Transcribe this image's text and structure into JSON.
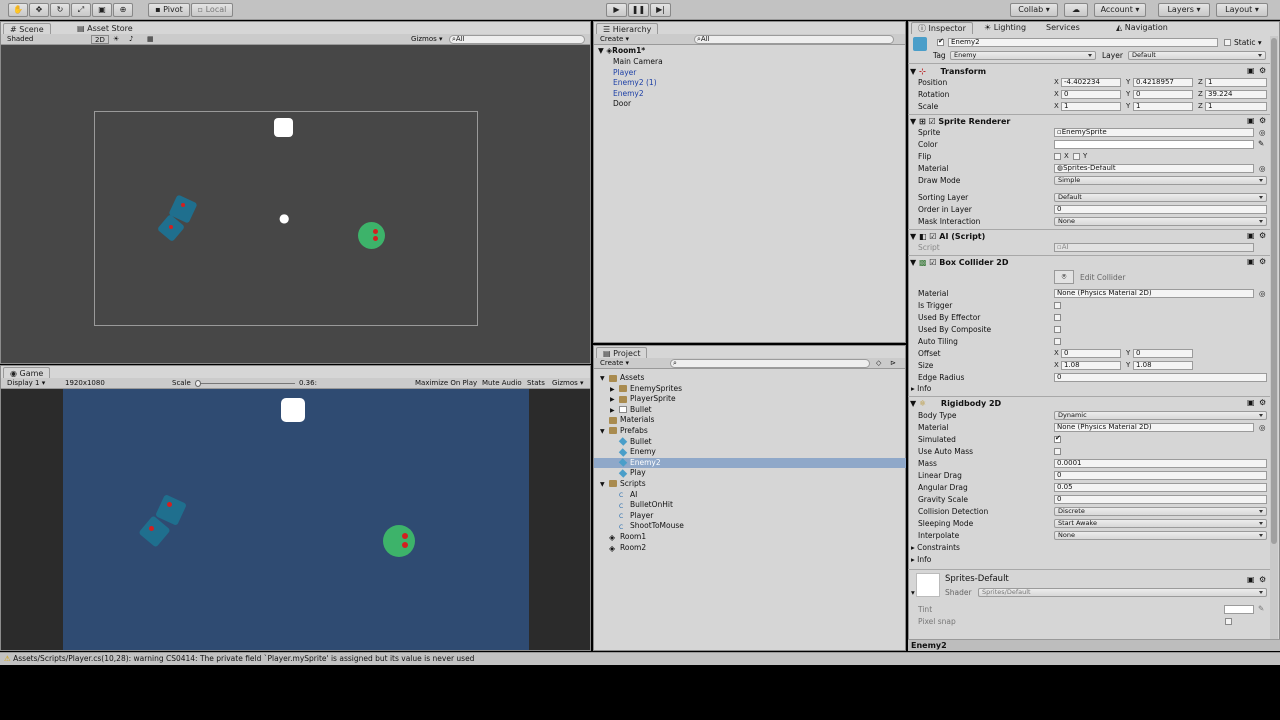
{
  "toolbar": {
    "pivot": "Pivot",
    "local": "Local",
    "collab": "Collab ▾",
    "account": "Account",
    "layers": "Layers",
    "layout": "Layout"
  },
  "scene": {
    "tab": "Scene",
    "tab2": "Asset Store",
    "shading": "Shaded",
    "mode2d": "2D",
    "gizmos": "Gizmos",
    "search": "All"
  },
  "game": {
    "tab": "Game",
    "display": "Display 1",
    "resolution": "1920x1080",
    "scale_label": "Scale",
    "scale_value": "0.36:",
    "maximize": "Maximize On Play",
    "mute": "Mute Audio",
    "stats": "Stats",
    "gizmos": "Gizmos"
  },
  "hierarchy": {
    "tab": "Hierarchy",
    "create": "Create",
    "search": "All",
    "scene": "Room1*",
    "items": [
      "Main Camera",
      "Player",
      "Enemy2 (1)",
      "Enemy2",
      "Door"
    ]
  },
  "project": {
    "tab": "Project",
    "create": "Create",
    "tree": [
      {
        "label": "Assets",
        "icon": "folder",
        "indent": 0,
        "arrow": "open"
      },
      {
        "label": "EnemySprites",
        "icon": "folder",
        "indent": 1,
        "arrow": "closed"
      },
      {
        "label": "PlayerSprite",
        "icon": "folder",
        "indent": 1,
        "arrow": "closed"
      },
      {
        "label": "Bullet",
        "icon": "sprite",
        "indent": 1,
        "arrow": "closed"
      },
      {
        "label": "Materials",
        "icon": "folder",
        "indent": 0,
        "arrow": "none"
      },
      {
        "label": "Prefabs",
        "icon": "folder",
        "indent": 0,
        "arrow": "open"
      },
      {
        "label": "Bullet",
        "icon": "prefab",
        "indent": 1,
        "arrow": "none"
      },
      {
        "label": "Enemy",
        "icon": "prefab",
        "indent": 1,
        "arrow": "none"
      },
      {
        "label": "Enemy2",
        "icon": "prefab",
        "indent": 1,
        "arrow": "none",
        "selected": true
      },
      {
        "label": "Play",
        "icon": "prefab",
        "indent": 1,
        "arrow": "none"
      },
      {
        "label": "Scripts",
        "icon": "folder",
        "indent": 0,
        "arrow": "open"
      },
      {
        "label": "AI",
        "icon": "script",
        "indent": 1,
        "arrow": "none"
      },
      {
        "label": "BulletOnHit",
        "icon": "script",
        "indent": 1,
        "arrow": "none"
      },
      {
        "label": "Player",
        "icon": "script",
        "indent": 1,
        "arrow": "none"
      },
      {
        "label": "ShootToMouse",
        "icon": "script",
        "indent": 1,
        "arrow": "none"
      },
      {
        "label": "Room1",
        "icon": "unity",
        "indent": 0,
        "arrow": "none"
      },
      {
        "label": "Room2",
        "icon": "unity",
        "indent": 0,
        "arrow": "none"
      }
    ]
  },
  "inspector": {
    "tabs": [
      "Inspector",
      "Lighting",
      "Services",
      "Navigation"
    ],
    "object_name": "Enemy2",
    "static": "Static",
    "tag_label": "Tag",
    "tag": "Enemy",
    "layer_label": "Layer",
    "layer": "Default",
    "transform": {
      "title": "Transform",
      "position": [
        "-4.402234",
        "0.4218957",
        "1"
      ],
      "rotation": [
        "0",
        "0",
        "39.224"
      ],
      "scale": [
        "1",
        "1",
        "1"
      ],
      "labels": {
        "position": "Position",
        "rotation": "Rotation",
        "scale": "Scale"
      }
    },
    "sprite_renderer": {
      "title": "Sprite Renderer",
      "sprite_label": "Sprite",
      "sprite": "EnemySprite",
      "color_label": "Color",
      "flip_label": "Flip",
      "flip_x": "X",
      "flip_y": "Y",
      "material_label": "Material",
      "material": "Sprites-Default",
      "draw_mode_label": "Draw Mode",
      "draw_mode": "Simple",
      "sorting_layer_label": "Sorting Layer",
      "sorting_layer": "Default",
      "order_label": "Order in Layer",
      "order": "0",
      "mask_label": "Mask Interaction",
      "mask": "None"
    },
    "ai": {
      "title": "AI (Script)",
      "script_label": "Script",
      "script": "AI"
    },
    "box_collider": {
      "title": "Box Collider 2D",
      "edit": "Edit Collider",
      "material_label": "Material",
      "material": "None (Physics Material 2D)",
      "is_trigger": "Is Trigger",
      "used_by_effector": "Used By Effector",
      "used_by_composite": "Used By Composite",
      "auto_tiling": "Auto Tiling",
      "offset_label": "Offset",
      "offset": [
        "0",
        "0"
      ],
      "size_label": "Size",
      "size": [
        "1.08",
        "1.08"
      ],
      "edge_label": "Edge Radius",
      "edge": "0",
      "info": "Info"
    },
    "rigidbody": {
      "title": "Rigidbody 2D",
      "body_type_label": "Body Type",
      "body_type": "Dynamic",
      "material_label": "Material",
      "material": "None (Physics Material 2D)",
      "simulated": "Simulated",
      "use_auto_mass": "Use Auto Mass",
      "mass_label": "Mass",
      "mass": "0.0001",
      "linear_drag_label": "Linear Drag",
      "linear_drag": "0",
      "angular_drag_label": "Angular Drag",
      "angular_drag": "0.05",
      "gravity_label": "Gravity Scale",
      "gravity": "0",
      "collision_label": "Collision Detection",
      "collision": "Discrete",
      "sleeping_label": "Sleeping Mode",
      "sleeping": "Start Awake",
      "interpolate_label": "Interpolate",
      "interpolate": "None",
      "constraints": "Constraints",
      "info": "Info"
    },
    "material_preview": {
      "name": "Sprites-Default",
      "shader_label": "Shader",
      "shader": "Sprites/Default",
      "tint": "Tint",
      "pixel_snap": "Pixel snap"
    },
    "footer": "Enemy2"
  },
  "console": {
    "message": "Assets/Scripts/Player.cs(10,28): warning CS0414: The private field `Player.mySprite' is assigned but its value is never used"
  },
  "colors": {
    "scene_bg": "#474747",
    "game_bg": "#2f4b72",
    "enemy": "#1f6f8e",
    "player": "#3db36a",
    "red": "#d22020"
  }
}
